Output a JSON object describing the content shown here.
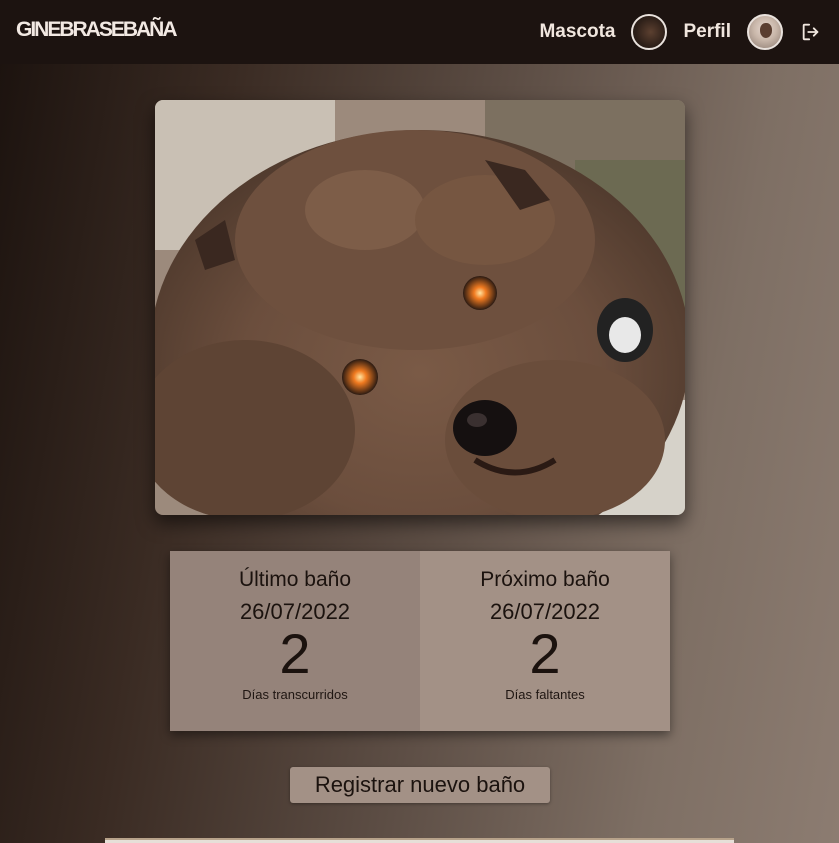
{
  "header": {
    "brand": "GINEBRASEBAÑA",
    "pet_label": "Mascota",
    "profile_label": "Perfil"
  },
  "pet_photo": {
    "icon": "dog-photo"
  },
  "stats": {
    "last": {
      "title": "Último baño",
      "date": "26/07/2022",
      "days": "2",
      "caption": "Días transcurridos"
    },
    "next": {
      "title": "Próximo baño",
      "date": "26/07/2022",
      "days": "2",
      "caption": "Días faltantes"
    }
  },
  "actions": {
    "register_label": "Registrar nuevo baño"
  },
  "colors": {
    "topbar": "#1c1310",
    "card_left": "#95837a",
    "card_right": "#a39186",
    "button": "#a39186"
  }
}
